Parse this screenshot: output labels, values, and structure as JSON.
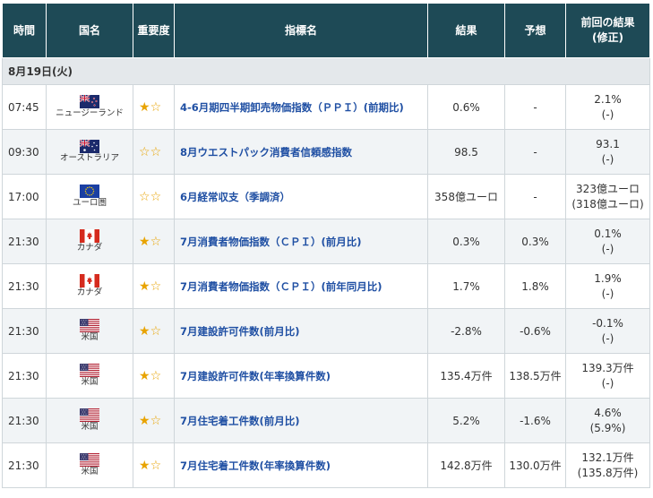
{
  "header": {
    "time": "時間",
    "country": "国名",
    "importance": "重要度",
    "indicator": "指標名",
    "result": "結果",
    "forecast": "予想",
    "previous_line1": "前回の結果",
    "previous_line2": "(修正)"
  },
  "date_label": "8月19日(火)",
  "colors": {
    "header_bg": "#1e4a56",
    "indicator_text": "#1f4fa3",
    "star": "#e8a300"
  },
  "rows": [
    {
      "time": "07:45",
      "country": "ニュージーランド",
      "flag": "nz-flag-icon",
      "stars_filled": 1,
      "indicator": "4-6月期四半期卸売物価指数（ＰＰＩ）(前期比)",
      "result": "0.6%",
      "forecast": "-",
      "previous": "2.1%",
      "revised": "(-)"
    },
    {
      "time": "09:30",
      "country": "オーストラリア",
      "flag": "au-flag-icon",
      "stars_filled": 0,
      "indicator": "8月ウエストパック消費者信頼感指数",
      "result": "98.5",
      "forecast": "-",
      "previous": "93.1",
      "revised": "(-)"
    },
    {
      "time": "17:00",
      "country": "ユーロ圏",
      "flag": "eu-flag-icon",
      "stars_filled": 0,
      "indicator": "6月経常収支（季調済）",
      "result": "358億ユーロ",
      "forecast": "-",
      "previous": "323億ユーロ",
      "revised": "(318億ユーロ)"
    },
    {
      "time": "21:30",
      "country": "カナダ",
      "flag": "ca-flag-icon",
      "stars_filled": 1,
      "indicator": "7月消費者物価指数（ＣＰＩ）(前月比)",
      "result": "0.3%",
      "forecast": "0.3%",
      "previous": "0.1%",
      "revised": "(-)"
    },
    {
      "time": "21:30",
      "country": "カナダ",
      "flag": "ca-flag-icon",
      "stars_filled": 1,
      "indicator": "7月消費者物価指数（ＣＰＩ）(前年同月比)",
      "result": "1.7%",
      "forecast": "1.8%",
      "previous": "1.9%",
      "revised": "(-)"
    },
    {
      "time": "21:30",
      "country": "米国",
      "flag": "us-flag-icon",
      "stars_filled": 1,
      "indicator": "7月建設許可件数(前月比)",
      "result": "-2.8%",
      "forecast": "-0.6%",
      "previous": "-0.1%",
      "revised": "(-)"
    },
    {
      "time": "21:30",
      "country": "米国",
      "flag": "us-flag-icon",
      "stars_filled": 1,
      "indicator": "7月建設許可件数(年率換算件数)",
      "result": "135.4万件",
      "forecast": "138.5万件",
      "previous": "139.3万件",
      "revised": "(-)"
    },
    {
      "time": "21:30",
      "country": "米国",
      "flag": "us-flag-icon",
      "stars_filled": 1,
      "indicator": "7月住宅着工件数(前月比)",
      "result": "5.2%",
      "forecast": "-1.6%",
      "previous": "4.6%",
      "revised": "(5.9%)"
    },
    {
      "time": "21:30",
      "country": "米国",
      "flag": "us-flag-icon",
      "stars_filled": 1,
      "indicator": "7月住宅着工件数(年率換算件数)",
      "result": "142.8万件",
      "forecast": "130.0万件",
      "previous": "132.1万件",
      "revised": "(135.8万件)"
    }
  ]
}
